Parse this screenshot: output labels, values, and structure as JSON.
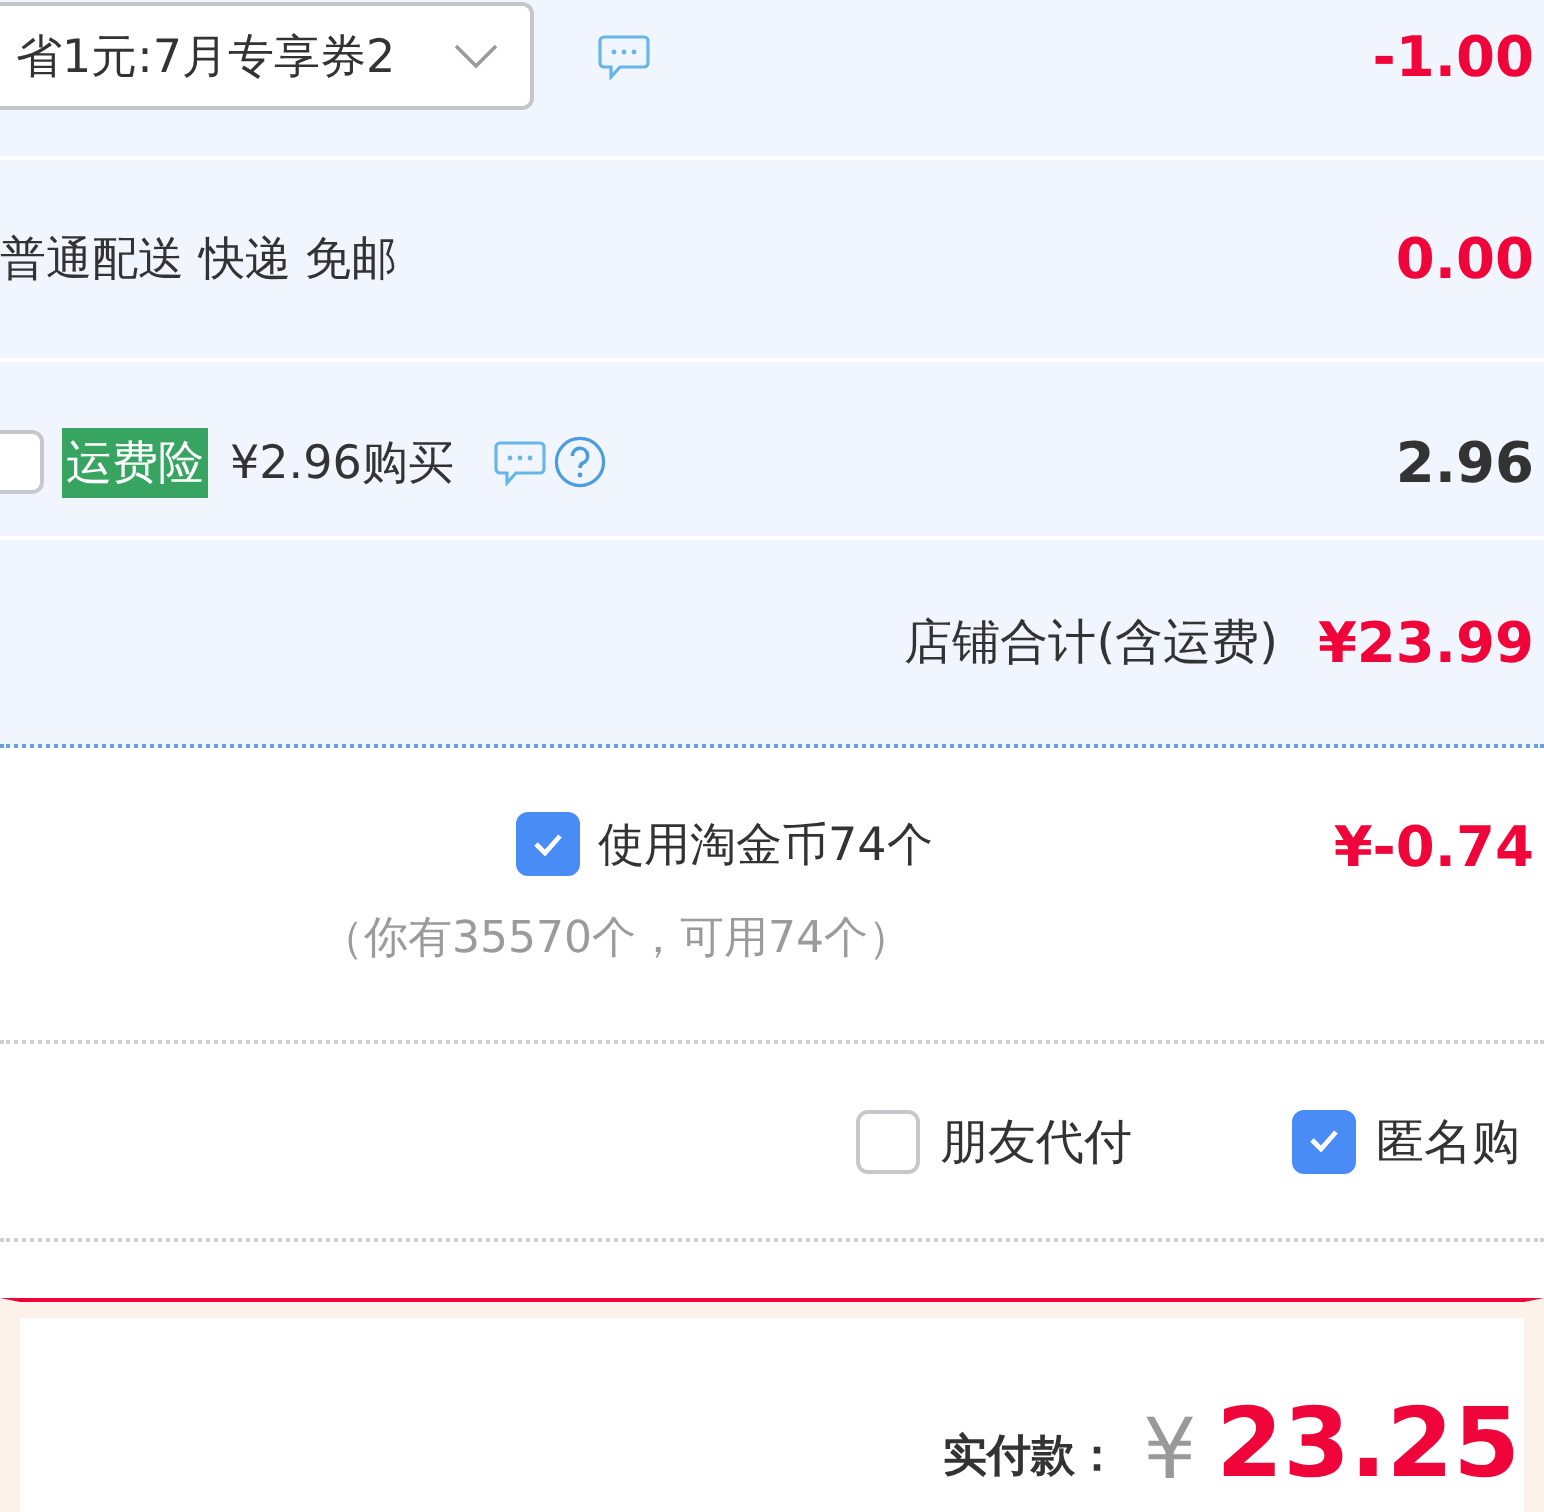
{
  "shop_rows": [
    {
      "kind": "coupon",
      "select": {
        "value": "省1元:7月专享券2"
      },
      "amount": "-1.00",
      "emphasized": true
    },
    {
      "kind": "shipping",
      "label": "普通配送 快递 免邮",
      "amount": "0.00",
      "emphasized": true
    },
    {
      "kind": "insurance",
      "checked": false,
      "tag": "运费险",
      "label": "¥2.96购买",
      "amount": "2.96",
      "emphasized": false
    }
  ],
  "shop_total": {
    "label": "店铺合计(含运费)",
    "amount": "¥23.99"
  },
  "coins": {
    "checked": true,
    "label": "使用淘金币74个",
    "note": "（你有35570个，可用74个）",
    "amount": "¥-0.74"
  },
  "options": [
    {
      "label": "朋友代付",
      "checked": false
    },
    {
      "label": "匿名购",
      "checked": true
    }
  ],
  "payment": {
    "label": "实付款：",
    "currency": "¥",
    "amount": "23.25"
  }
}
